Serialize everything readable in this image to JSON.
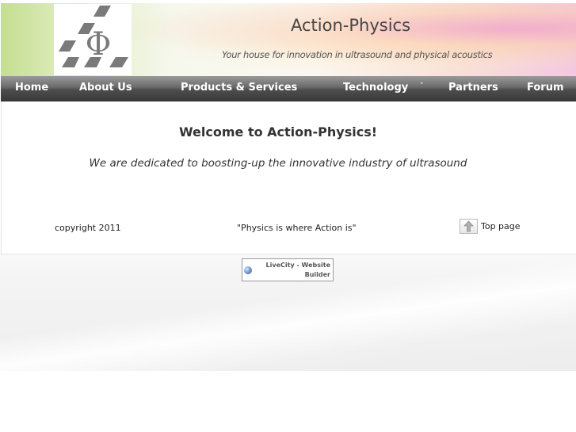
{
  "header": {
    "title": "Action-Physics",
    "tagline": "Your house for innovation in ultrasound and physical acoustics",
    "logo_symbol": "Φ"
  },
  "nav": {
    "items": [
      {
        "label": "Home"
      },
      {
        "label": "About Us"
      },
      {
        "label": "Products & Services"
      },
      {
        "label": "Technology"
      },
      {
        "label": "Partners"
      },
      {
        "label": "Forum"
      }
    ],
    "dropdown_glyph": "˅"
  },
  "main": {
    "welcome": "Welcome to Action-Physics!",
    "dedicated": "We are dedicated to boosting-up the innovative industry of ultrasound"
  },
  "footer": {
    "copyright": "copyright 2011",
    "motto": "\"Physics is where Action is\"",
    "top_page": "Top page"
  },
  "badge": {
    "text": "LiveCity - Website Builder"
  },
  "colors": {
    "nav_bg": "#4e4e4e",
    "text_dark": "#333333",
    "logo_gray": "#7a7a7a"
  }
}
